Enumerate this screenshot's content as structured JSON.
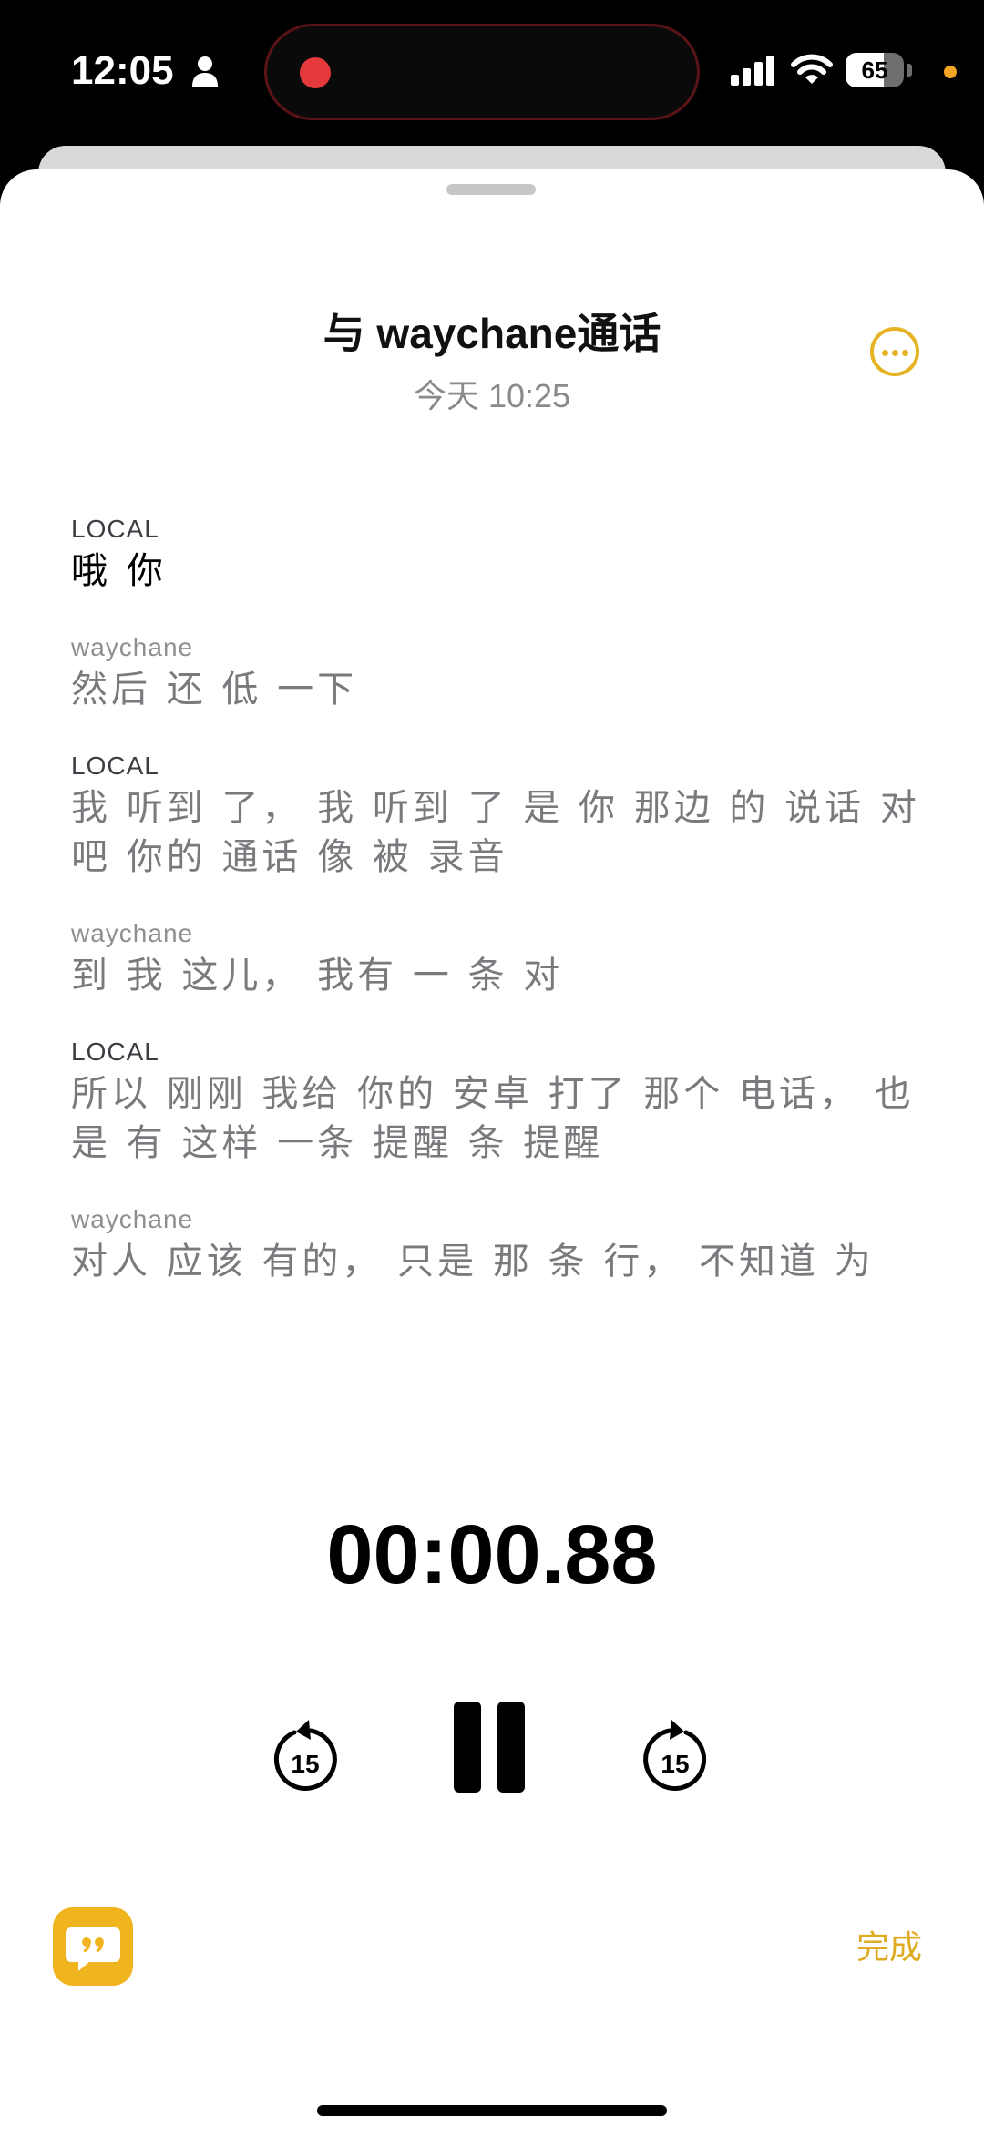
{
  "status_bar": {
    "time": "12:05",
    "battery_percent": "65",
    "battery_level": 0.65
  },
  "header": {
    "title": "与 waychane通话",
    "subtitle": "今天 10:25"
  },
  "transcript": [
    {
      "speaker": "LOCAL",
      "text": "哦 你"
    },
    {
      "speaker": "waychane",
      "text": "然后 还 低 一下"
    },
    {
      "speaker": "LOCAL",
      "text": "我 听到 了，  我 听到 了 是 你 那边 的 说话 对 吧 你的 通话 像 被 录音"
    },
    {
      "speaker": "waychane",
      "text": "到 我 这儿，  我有 一 条 对"
    },
    {
      "speaker": "LOCAL",
      "text": "所以 刚刚 我给 你的 安卓 打了 那个 电话，  也是 有 这样 一条 提醒 条 提醒"
    },
    {
      "speaker": "waychane",
      "text": "对人 应该 有的，  只是 那 条 行，  不知道 为"
    }
  ],
  "player": {
    "elapsed": "00:00.88",
    "skip_back_seconds": "15",
    "skip_forward_seconds": "15"
  },
  "footer": {
    "done_label": "完成"
  },
  "colors": {
    "accent": "#e6b325",
    "record_dot": "#e5393c"
  }
}
